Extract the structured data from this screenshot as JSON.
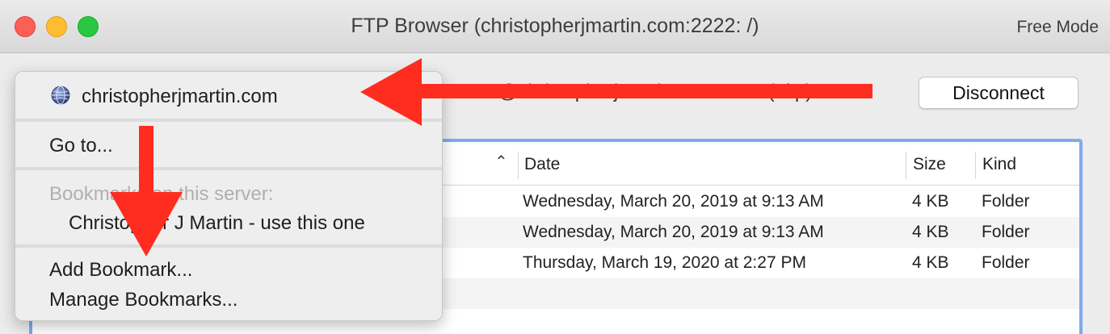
{
  "window": {
    "title": "FTP Browser (christopherjmartin.com:2222: /)",
    "mode": "Free Mode"
  },
  "toolbar": {
    "connection_path": "03320@christopherjmartin.com:2222 (sftp)",
    "disconnect_label": "Disconnect"
  },
  "menu": {
    "server": "christopherjmartin.com",
    "goto": "Go to...",
    "bookmarks_header": "Bookmarks on this server:",
    "bookmark_item": "Christopher J Martin - use this one",
    "add_bookmark": "Add Bookmark...",
    "manage_bookmarks": "Manage Bookmarks..."
  },
  "table": {
    "columns": [
      "Date",
      "Size",
      "Kind"
    ],
    "rows": [
      {
        "date": "Wednesday, March 20, 2019 at 9:13 AM",
        "size": "4 KB",
        "kind": "Folder"
      },
      {
        "date": "Wednesday, March 20, 2019 at 9:13 AM",
        "size": "4 KB",
        "kind": "Folder"
      },
      {
        "date": "Thursday, March 19, 2020 at 2:27 PM",
        "size": "4 KB",
        "kind": "Folder"
      }
    ]
  },
  "colors": {
    "annotation_arrow": "#ff2d20",
    "table_focus_border": "#7eaaea"
  },
  "icons": {
    "server": "globe-icon",
    "sort": "chevron-up-icon"
  }
}
